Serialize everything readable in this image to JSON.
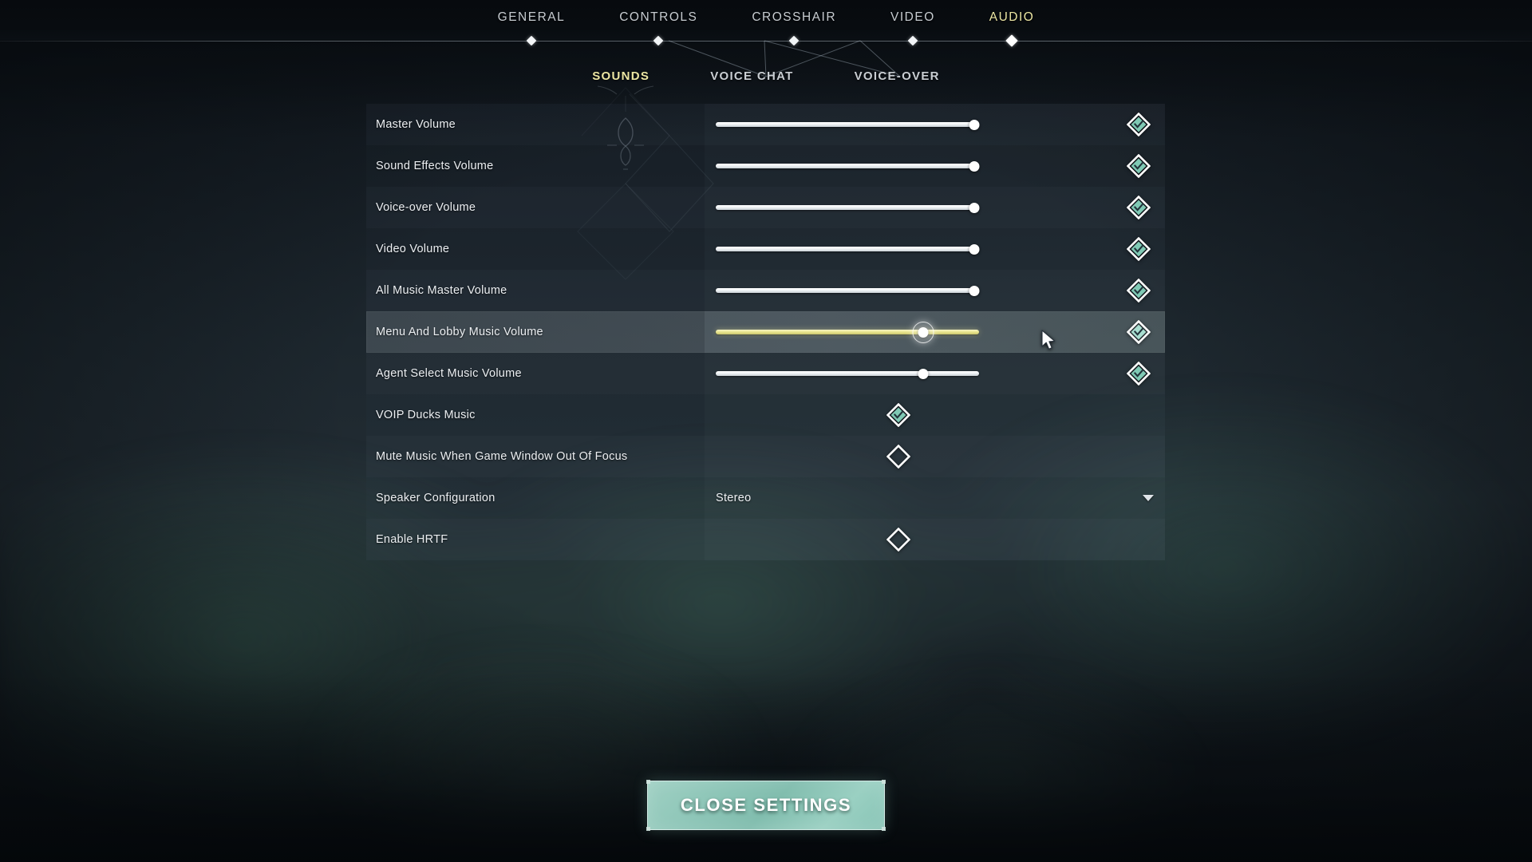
{
  "nav": {
    "tabs": [
      {
        "label": "GENERAL",
        "active": false
      },
      {
        "label": "CONTROLS",
        "active": false
      },
      {
        "label": "CROSSHAIR",
        "active": false
      },
      {
        "label": "VIDEO",
        "active": false
      },
      {
        "label": "AUDIO",
        "active": true
      }
    ]
  },
  "subnav": {
    "tabs": [
      {
        "label": "SOUNDS",
        "active": true
      },
      {
        "label": "VOICE CHAT",
        "active": false
      },
      {
        "label": "VOICE-OVER",
        "active": false
      }
    ]
  },
  "settings": {
    "rows": [
      {
        "label": "Master Volume",
        "type": "slider",
        "value": 100,
        "checked": true,
        "hover": false
      },
      {
        "label": "Sound Effects Volume",
        "type": "slider",
        "value": 100,
        "checked": true,
        "hover": false
      },
      {
        "label": "Voice-over Volume",
        "type": "slider",
        "value": 100,
        "checked": true,
        "hover": false
      },
      {
        "label": "Video Volume",
        "type": "slider",
        "value": 100,
        "checked": true,
        "hover": false
      },
      {
        "label": "All Music Master Volume",
        "type": "slider",
        "value": 100,
        "checked": true,
        "hover": false
      },
      {
        "label": "Menu And Lobby Music Volume",
        "type": "slider",
        "value": 80,
        "checked": true,
        "hover": true
      },
      {
        "label": "Agent Select Music Volume",
        "type": "slider",
        "value": 80,
        "checked": true,
        "hover": false
      },
      {
        "label": "VOIP Ducks Music",
        "type": "checkbox",
        "checked": true,
        "hover": false
      },
      {
        "label": "Mute Music When Game Window Out Of Focus",
        "type": "checkbox",
        "checked": false,
        "hover": false
      },
      {
        "label": "Speaker Configuration",
        "type": "dropdown",
        "value": "Stereo",
        "hover": false
      },
      {
        "label": "Enable HRTF",
        "type": "checkbox",
        "checked": false,
        "hover": false
      }
    ]
  },
  "footer": {
    "close_label": "CLOSE SETTINGS"
  },
  "colors": {
    "accent_yellow": "#ece6a3",
    "accent_mint": "#7fc9b4",
    "text_primary": "#eceff2",
    "panel_row_even": "#1e252d",
    "panel_row_odd": "#161d24",
    "button_teal": "#8ec6b8"
  }
}
